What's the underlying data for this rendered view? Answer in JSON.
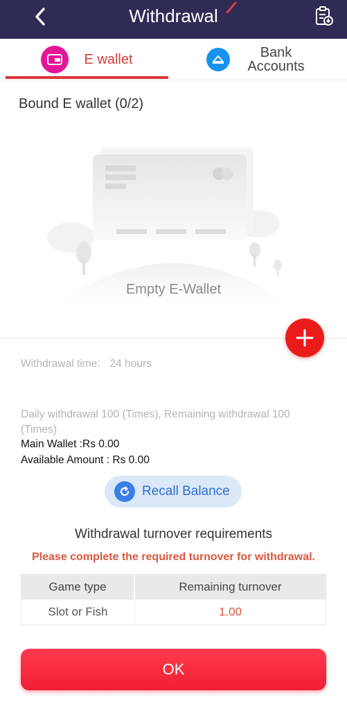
{
  "header": {
    "title": "Withdrawal",
    "back_icon": "chevron-left-icon",
    "record_icon": "clipboard-download-icon"
  },
  "tabs": [
    {
      "label": "E wallet",
      "icon": "wallet-icon",
      "active": true
    },
    {
      "label": "Bank Accounts",
      "icon": "bank-card-icon",
      "active": false
    }
  ],
  "bound": {
    "title": "Bound E wallet (0/2)",
    "empty_label": "Empty E-Wallet"
  },
  "info": {
    "withdrawal_time_label": "Withdrawal time:",
    "withdrawal_time_value": "24 hours",
    "daily_text": "Daily withdrawal 100 (Times), Remaining withdrawal 100 (Times)",
    "main_wallet": "Main Wallet :Rs 0.00",
    "available_amount": "Available Amount : Rs 0.00"
  },
  "recall": {
    "label": "Recall Balance",
    "icon": "refresh-icon"
  },
  "turnover": {
    "title": "Withdrawal turnover requirements",
    "warning": "Please complete the required turnover for withdrawal.",
    "columns": [
      "Game type",
      "Remaining turnover"
    ],
    "rows": [
      [
        "Slot or Fish",
        "1.00"
      ]
    ]
  },
  "ok_label": "OK",
  "colors": {
    "header_bg": "#2e2b55",
    "accent_red": "#ec1b1b",
    "tab_active": "#d43b3b",
    "ewallet_icon": "#e5159a",
    "bank_icon": "#1593ee",
    "recall_blue": "#3a7fe6"
  }
}
